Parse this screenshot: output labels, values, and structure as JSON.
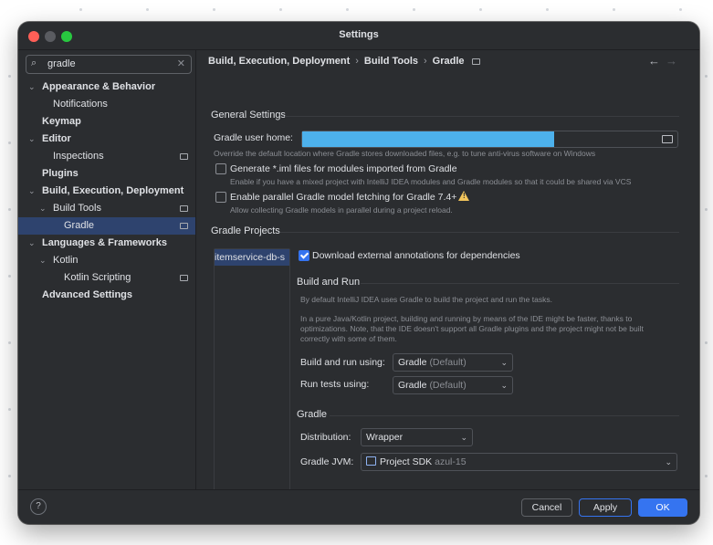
{
  "window": {
    "title": "Settings"
  },
  "search": {
    "value": "gradle"
  },
  "tree": [
    {
      "label": "Appearance & Behavior",
      "bold": true,
      "expanded": true,
      "level": 0
    },
    {
      "label": "Notifications",
      "bold": false,
      "level": 1
    },
    {
      "label": "Keymap",
      "bold": true,
      "level": 0
    },
    {
      "label": "Editor",
      "bold": true,
      "expanded": true,
      "level": 0
    },
    {
      "label": "Inspections",
      "bold": false,
      "level": 1,
      "pinned": true
    },
    {
      "label": "Plugins",
      "bold": true,
      "level": 0
    },
    {
      "label": "Build, Execution, Deployment",
      "bold": true,
      "expanded": true,
      "level": 0
    },
    {
      "label": "Build Tools",
      "bold": false,
      "expanded": true,
      "level": 1,
      "pinned": true
    },
    {
      "label": "Gradle",
      "bold": false,
      "level": 2,
      "pinned": true,
      "selected": true
    },
    {
      "label": "Languages & Frameworks",
      "bold": true,
      "expanded": true,
      "level": 0
    },
    {
      "label": "Kotlin",
      "bold": false,
      "expanded": true,
      "level": 1
    },
    {
      "label": "Kotlin Scripting",
      "bold": false,
      "level": 2,
      "pinned": true
    },
    {
      "label": "Advanced Settings",
      "bold": true,
      "level": 0
    }
  ],
  "breadcrumb": [
    "Build, Execution, Deployment",
    "Build Tools",
    "Gradle"
  ],
  "general": {
    "title": "General Settings",
    "user_home_label": "Gradle user home:",
    "user_home_hint": "Override the default location where Gradle stores downloaded files, e.g. to tune anti-virus software on Windows",
    "iml_label": "Generate *.iml files for modules imported from Gradle",
    "iml_checked": false,
    "iml_hint": "Enable if you have a mixed project with IntelliJ IDEA modules and Gradle modules so that it could be shared via VCS",
    "parallel_label": "Enable parallel Gradle model fetching for Gradle 7.4+",
    "parallel_checked": false,
    "parallel_hint": "Allow collecting Gradle models in parallel during a project reload."
  },
  "projects": {
    "title": "Gradle Projects",
    "items": [
      "itemservice-db-s"
    ],
    "download_annotations_label": "Download external annotations for dependencies",
    "download_annotations_checked": true
  },
  "build_run": {
    "title": "Build and Run",
    "desc1": "By default IntelliJ IDEA uses Gradle to build the project and run the tasks.",
    "desc2": "In a pure Java/Kotlin project, building and running by means of the IDE might be faster, thanks to optimizations. Note, that the IDE doesn't support all Gradle plugins and the project might not be built correctly with some of them.",
    "build_using_label": "Build and run using:",
    "build_using_value": "Gradle",
    "build_using_suffix": "(Default)",
    "tests_using_label": "Run tests using:",
    "tests_using_value": "Gradle",
    "tests_using_suffix": "(Default)"
  },
  "gradle": {
    "title": "Gradle",
    "distribution_label": "Distribution:",
    "distribution_value": "Wrapper",
    "jvm_label": "Gradle JVM:",
    "jvm_value": "Project SDK",
    "jvm_suffix": "azul-15"
  },
  "footer": {
    "help": "?",
    "cancel": "Cancel",
    "apply": "Apply",
    "ok": "OK"
  },
  "colors": {
    "accent": "#3574f0",
    "selection": "#2e436e",
    "path_highlight": "#4db1ec",
    "warning": "#f2c55c"
  }
}
